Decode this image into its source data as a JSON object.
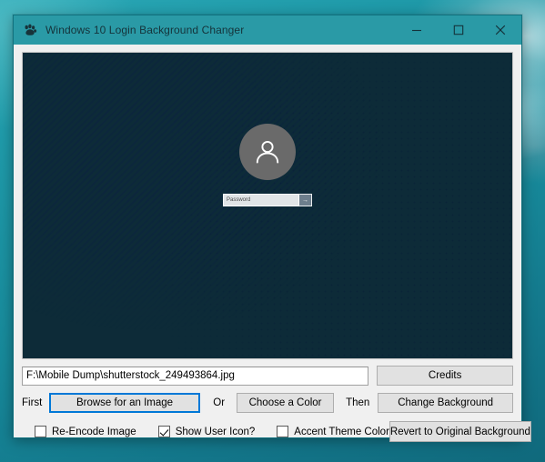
{
  "window": {
    "title": "Windows 10 Login Background Changer",
    "app_icon": "paw-icon",
    "minimize_label": "—",
    "maximize_label": "☐",
    "close_label": "✕",
    "titlebar_color": "#2a9aa6",
    "body_color": "#f0f0f0"
  },
  "desktop": {
    "background_color": "#17899a"
  },
  "preview": {
    "avatar_icon": "user-avatar-icon",
    "password_placeholder": "Password",
    "password_value": "",
    "submit_arrow": "→"
  },
  "controls": {
    "path_value": "F:\\Mobile Dump\\shutterstock_249493864.jpg",
    "path_placeholder": "",
    "first_label": "First",
    "browse_label": "Browse for an Image",
    "or_label": "Or",
    "choose_color_label": "Choose a Color",
    "then_label": "Then",
    "credits_label": "Credits",
    "change_background_label": "Change Background",
    "revert_label": "Revert to Original Background",
    "focus_accent_color": "#0078d7"
  },
  "checkboxes": [
    {
      "label": "Re-Encode Image",
      "checked": false
    },
    {
      "label": "Show User Icon?",
      "checked": true
    },
    {
      "label": "Accent Theme Color",
      "checked": false
    }
  ]
}
